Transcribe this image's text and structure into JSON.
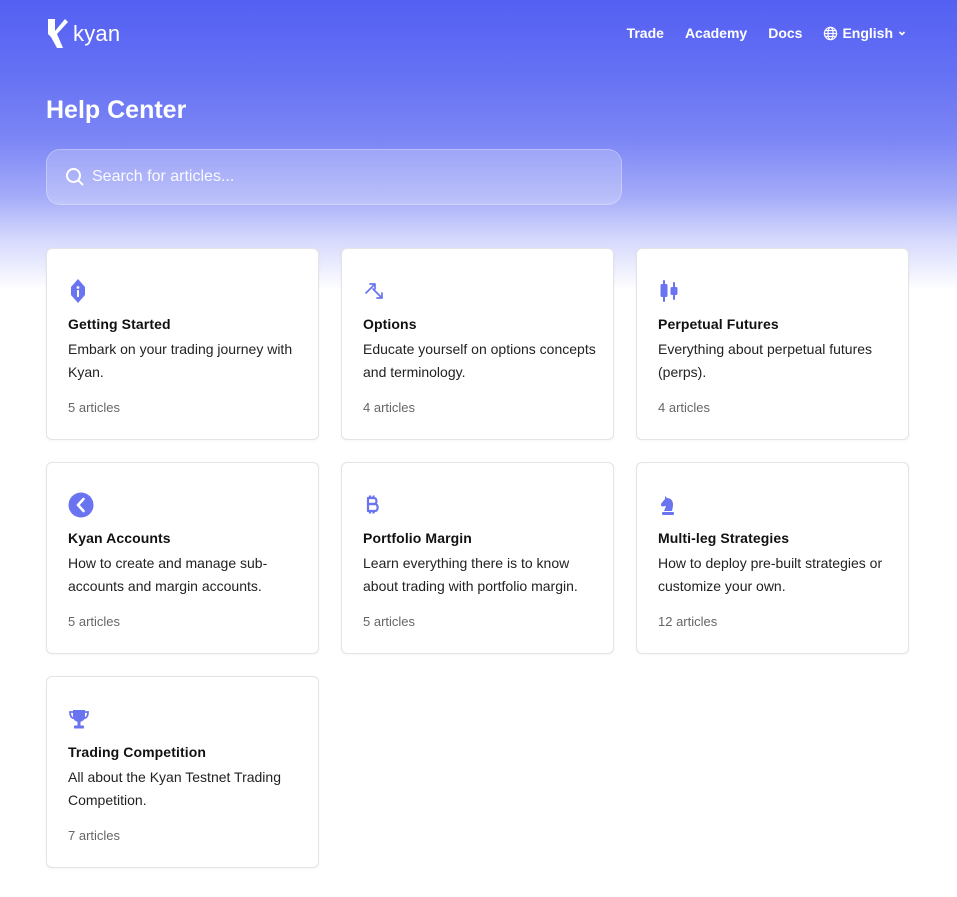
{
  "header": {
    "logo_text": "kyan",
    "nav": [
      {
        "label": "Trade"
      },
      {
        "label": "Academy"
      },
      {
        "label": "Docs"
      }
    ],
    "language": {
      "label": "English",
      "icon": "globe-icon",
      "dropdown_icon": "chevron-down-icon"
    }
  },
  "hero": {
    "title": "Help Center",
    "search": {
      "placeholder": "Search for articles...",
      "value": "",
      "icon": "search-icon"
    }
  },
  "theme": {
    "accent": "#5b63f0",
    "icon_color": "#6a74f0"
  },
  "collections": [
    {
      "icon": "info-badge-icon",
      "title": "Getting Started",
      "description": "Embark on your trading journey with Kyan.",
      "count": "5 articles"
    },
    {
      "icon": "arrows-swap-icon",
      "title": "Options",
      "description": "Educate yourself on options concepts and terminology.",
      "count": "4 articles"
    },
    {
      "icon": "candlestick-icon",
      "title": "Perpetual Futures",
      "description": "Everything about perpetual futures (perps).",
      "count": "4 articles"
    },
    {
      "icon": "kyan-circle-icon",
      "title": "Kyan Accounts",
      "description": "How to create and manage sub-accounts and margin accounts.",
      "count": "5 articles"
    },
    {
      "icon": "bitcoin-icon",
      "title": "Portfolio Margin",
      "description": "Learn everything there is to know about trading with portfolio margin.",
      "count": "5 articles"
    },
    {
      "icon": "chess-knight-icon",
      "title": "Multi-leg Strategies",
      "description": "How to deploy pre-built strategies or customize your own.",
      "count": "12 articles"
    },
    {
      "icon": "trophy-icon",
      "title": "Trading Competition",
      "description": "All about the Kyan Testnet Trading Competition.",
      "count": "7 articles"
    }
  ]
}
